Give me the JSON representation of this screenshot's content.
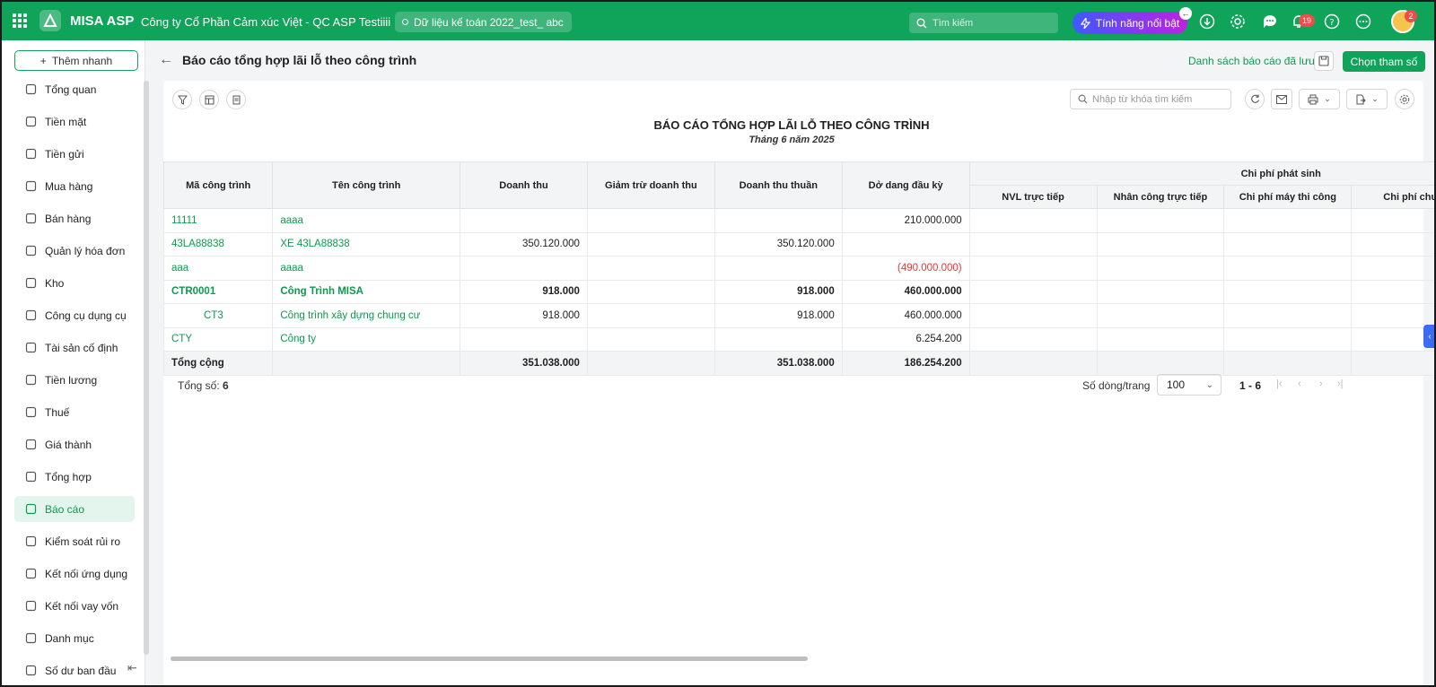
{
  "topbar": {
    "brand": "MISA ASP",
    "company": "Công ty Cổ Phần Cảm xúc Việt - QC ASP Testiiii",
    "database": "Dữ liệu kế toán 2022_test_ abc",
    "search_placeholder": "Tìm kiếm",
    "feature_label": "Tính năng nổi bật",
    "notification_count": "19",
    "avatar_badge": "2",
    "brand_color": "#10a35a"
  },
  "sidebar": {
    "quick_add": "Thêm nhanh",
    "items": [
      {
        "label": "Tổng quan",
        "icon": "dashboard-icon"
      },
      {
        "label": "Tiền mặt",
        "icon": "cash-icon"
      },
      {
        "label": "Tiền gửi",
        "icon": "bank-icon"
      },
      {
        "label": "Mua hàng",
        "icon": "shopping-bag-icon"
      },
      {
        "label": "Bán hàng",
        "icon": "cart-icon"
      },
      {
        "label": "Quản lý hóa đơn",
        "icon": "invoice-icon"
      },
      {
        "label": "Kho",
        "icon": "warehouse-icon"
      },
      {
        "label": "Công cụ dụng cụ",
        "icon": "tools-icon"
      },
      {
        "label": "Tài sản cố định",
        "icon": "car-icon"
      },
      {
        "label": "Tiền lương",
        "icon": "payroll-icon"
      },
      {
        "label": "Thuế",
        "icon": "tax-icon"
      },
      {
        "label": "Giá thành",
        "icon": "cost-icon"
      },
      {
        "label": "Tổng hợp",
        "icon": "summary-icon"
      },
      {
        "label": "Báo cáo",
        "icon": "report-icon",
        "active": true
      },
      {
        "label": "Kiểm soát rủi ro",
        "icon": "risk-icon"
      },
      {
        "label": "Kết nối ứng dụng",
        "icon": "plug-icon"
      },
      {
        "label": "Kết nối vay vốn",
        "icon": "loan-icon"
      },
      {
        "label": "Danh mục",
        "icon": "list-icon"
      },
      {
        "label": "Số dư ban đầu",
        "icon": "balance-icon"
      }
    ]
  },
  "page": {
    "title": "Báo cáo tổng hợp lãi lỗ theo công trình",
    "saved_reports": "Danh sách báo cáo đã lưu",
    "choose_params": "Chọn tham số"
  },
  "toolbar": {
    "search_placeholder": "Nhập từ khóa tìm kiếm"
  },
  "report": {
    "title": "BÁO CÁO TỔNG HỢP LÃI LỖ THEO CÔNG TRÌNH",
    "subtitle": "Tháng 6 năm 2025",
    "columns": {
      "code": "Mã công trình",
      "name": "Tên công trình",
      "revenue": "Doanh thu",
      "deduction": "Giảm trừ doanh thu",
      "net_revenue": "Doanh thu thuần",
      "wip_opening": "Dở dang đầu kỳ",
      "cost_group": "Chi phí phát sinh",
      "material": "NVL trực tiếp",
      "labor": "Nhân công trực tiếp",
      "machine": "Chi phí máy thi công",
      "general": "Chi phí chu"
    },
    "rows": [
      {
        "code": "11111",
        "name": "aaaa",
        "revenue": "",
        "deduction": "",
        "net_revenue": "",
        "wip_opening": "210.000.000",
        "bold": false,
        "indent": false,
        "negative": false
      },
      {
        "code": "43LA88838",
        "name": "XE 43LA88838",
        "revenue": "350.120.000",
        "deduction": "",
        "net_revenue": "350.120.000",
        "wip_opening": "",
        "bold": false,
        "indent": false,
        "negative": false
      },
      {
        "code": "aaa",
        "name": "aaaa",
        "revenue": "",
        "deduction": "",
        "net_revenue": "",
        "wip_opening": "(490.000.000)",
        "bold": false,
        "indent": false,
        "negative": true
      },
      {
        "code": "CTR0001",
        "name": "Công Trình MISA",
        "revenue": "918.000",
        "deduction": "",
        "net_revenue": "918.000",
        "wip_opening": "460.000.000",
        "bold": true,
        "indent": false,
        "negative": false
      },
      {
        "code": "CT3",
        "name": "Công trình xây dựng chung cư",
        "revenue": "918.000",
        "deduction": "",
        "net_revenue": "918.000",
        "wip_opening": "460.000.000",
        "bold": false,
        "indent": true,
        "negative": false
      },
      {
        "code": "CTY",
        "name": "Công ty",
        "revenue": "",
        "deduction": "",
        "net_revenue": "",
        "wip_opening": "6.254.200",
        "bold": false,
        "indent": false,
        "negative": false
      }
    ],
    "total": {
      "label": "Tổng cộng",
      "revenue": "351.038.000",
      "net_revenue": "351.038.000",
      "wip_opening": "186.254.200"
    }
  },
  "footer": {
    "count_label": "Tổng số:",
    "count_value": "6",
    "rows_per_page_label": "Số dòng/trang",
    "rows_per_page": "100",
    "range": "1 - 6"
  }
}
